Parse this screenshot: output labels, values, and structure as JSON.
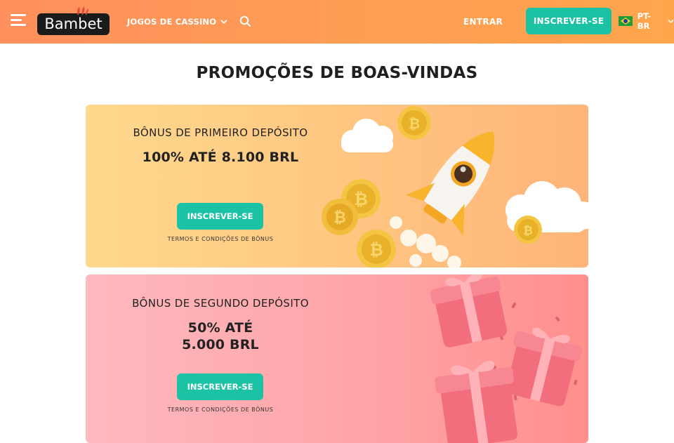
{
  "header": {
    "logo_text": "Bambet",
    "nav_games_label": "JOGOS DE CASSINO",
    "login_label": "ENTRAR",
    "signup_label": "INSCREVER-SE",
    "language_label": "PT-BR",
    "icons": [
      "menu-icon",
      "chevron-down-icon",
      "search-icon",
      "brazil-flag-icon"
    ]
  },
  "page": {
    "title": "PROMOÇÕES DE BOAS-VINDAS"
  },
  "promos": [
    {
      "subtitle": "BÔNUS DE PRIMEIRO DEPÓSITO",
      "headline_lines": [
        "100% ATÉ 8.100 BRL"
      ],
      "button_label": "INSCREVER-SE",
      "terms_label": "TERMOS E CONDIÇÕES DE BÔNUS",
      "illustration": "rocket-with-bitcoin-coins"
    },
    {
      "subtitle": "BÔNUS DE SEGUNDO DEPÓSITO",
      "headline_lines": [
        "50% ATÉ",
        "5.000 BRL"
      ],
      "button_label": "INSCREVER-SE",
      "terms_label": "TERMOS E CONDIÇÕES DE BÔNUS",
      "illustration": "pink-gift-boxes"
    }
  ],
  "colors": {
    "header_gradient_start": "#ff8f5c",
    "header_gradient_end": "#ffa64d",
    "accent_button": "#1cc2a4",
    "promo1_bg": "#ffc581",
    "promo2_bg": "#ffa4a8"
  }
}
